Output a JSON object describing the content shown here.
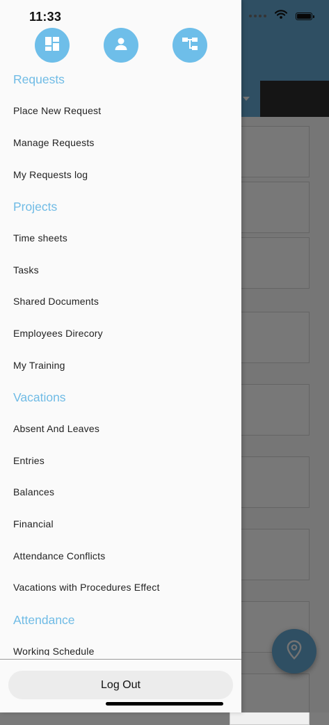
{
  "status_bar": {
    "time": "11:33"
  },
  "drawer": {
    "top_icons": [
      "dashboard-icon",
      "person-icon",
      "org-chart-icon"
    ],
    "sections": [
      {
        "title": "Requests",
        "items": [
          "Place New Request",
          "Manage Requests",
          "My Requests log"
        ]
      },
      {
        "title": "Projects",
        "items": [
          "Time sheets",
          "Tasks",
          "Shared Documents",
          "Employees Direcory",
          "My Training"
        ]
      },
      {
        "title": "Vacations",
        "items": [
          "Absent And Leaves",
          "Entries",
          "Balances",
          "Financial",
          "Attendance Conflicts",
          "Vacations with Procedures Effect"
        ]
      },
      {
        "title": "Attendance",
        "items": [
          "Working Schedule"
        ]
      }
    ],
    "logout_label": "Log Out"
  },
  "background": {
    "fab_icon": "location-pin-icon"
  },
  "colors": {
    "accent": "#6fbbe5",
    "icon_bg": "#6ebee9",
    "header": "#5f9ec6"
  }
}
